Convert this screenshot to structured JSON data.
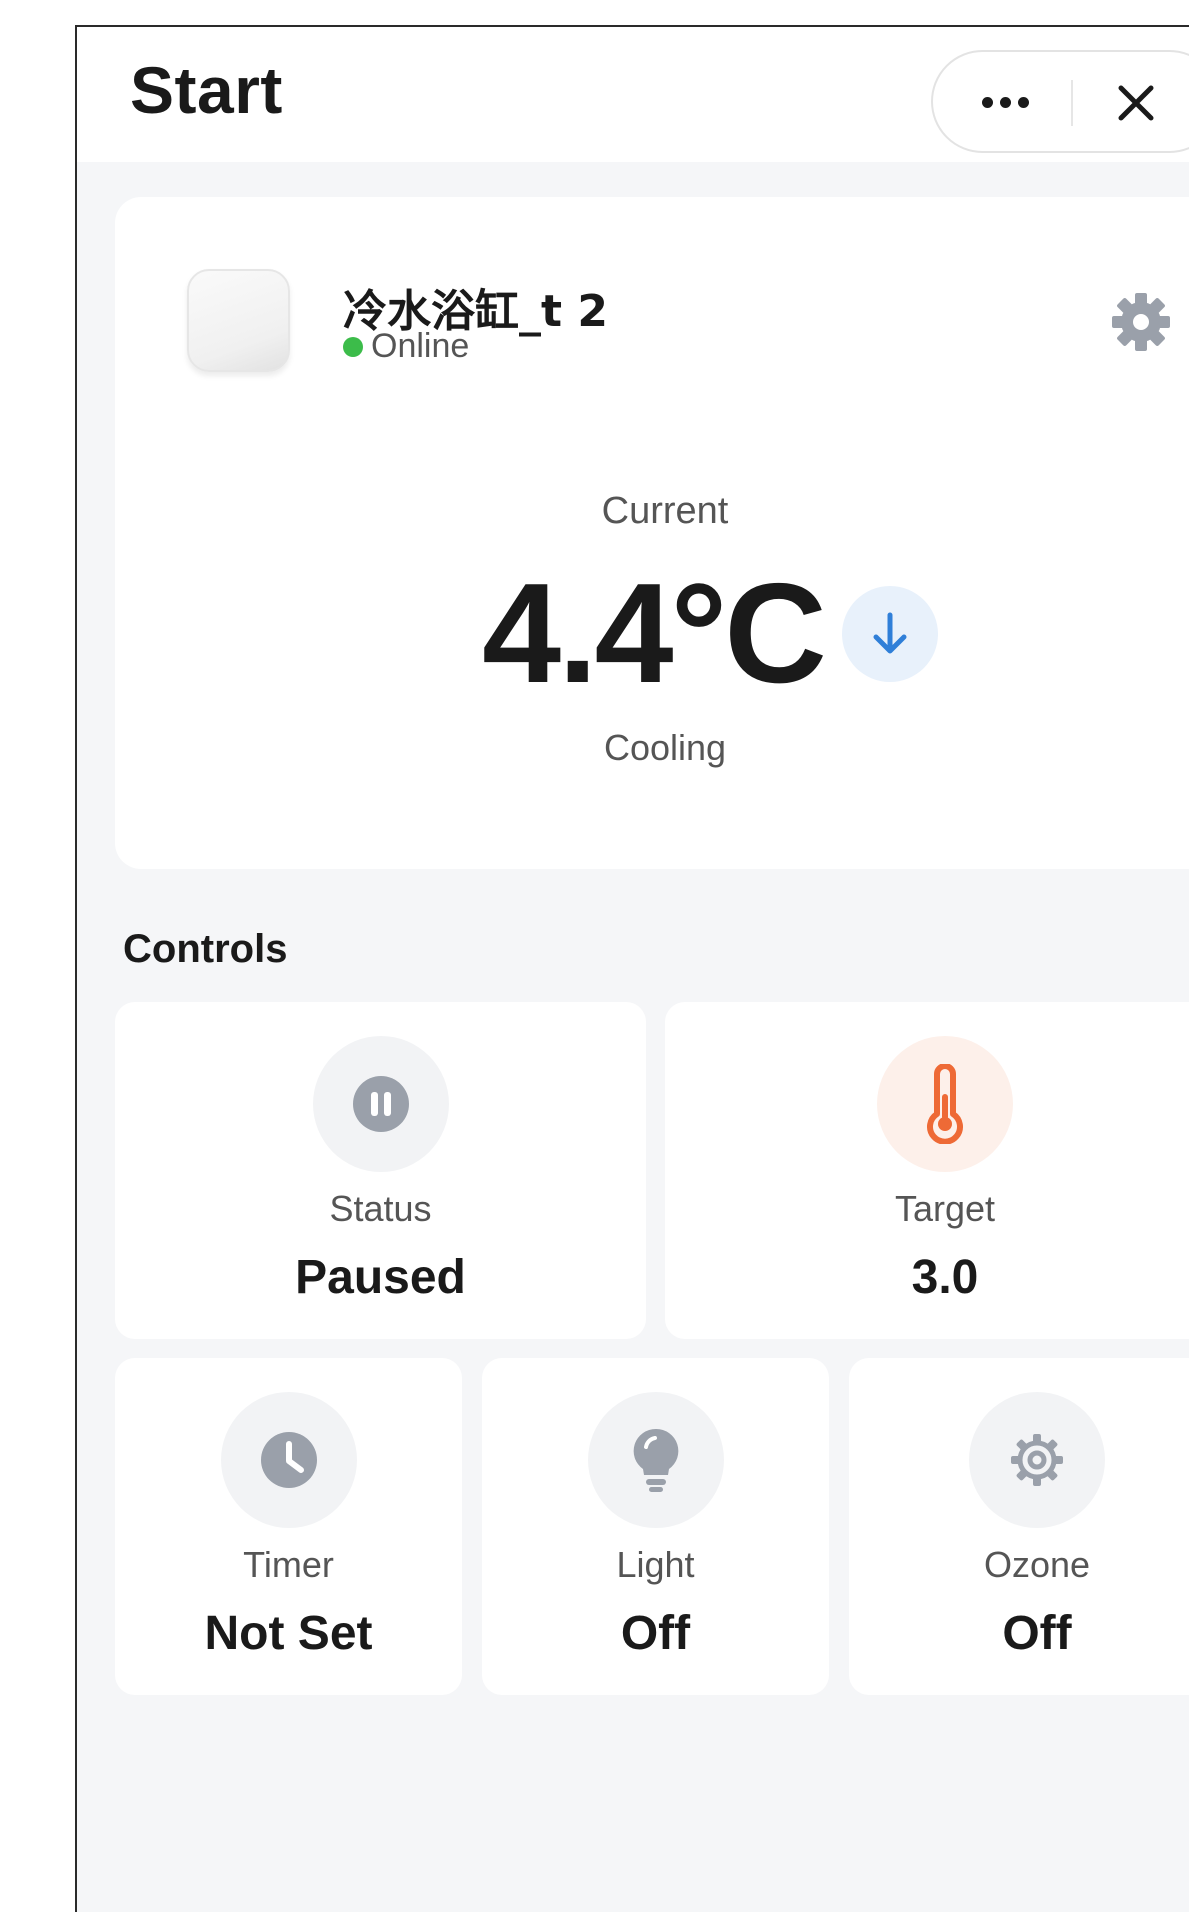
{
  "titlebar": {
    "title": "Start",
    "more_icon": "more-dots-icon",
    "close_icon": "close-icon"
  },
  "device": {
    "name": "冷水浴缸_t 2",
    "status": "Online",
    "status_color": "#3cbc4a",
    "settings_icon": "gear-icon",
    "current_label": "Current",
    "temperature": "4.4°C",
    "trend_icon": "arrow-down-icon",
    "trend_color": "#2f7fd8",
    "mode": "Cooling"
  },
  "controls": {
    "title": "Controls",
    "tiles": [
      {
        "label": "Status",
        "value": "Paused",
        "icon": "pause-icon"
      },
      {
        "label": "Target",
        "value": "3.0",
        "icon": "thermometer-icon",
        "accent": "#ee6a36"
      },
      {
        "label": "Timer",
        "value": "Not Set",
        "icon": "clock-icon"
      },
      {
        "label": "Light",
        "value": "Off",
        "icon": "bulb-icon"
      },
      {
        "label": "Ozone",
        "value": "Off",
        "icon": "ozone-gear-icon"
      }
    ]
  }
}
